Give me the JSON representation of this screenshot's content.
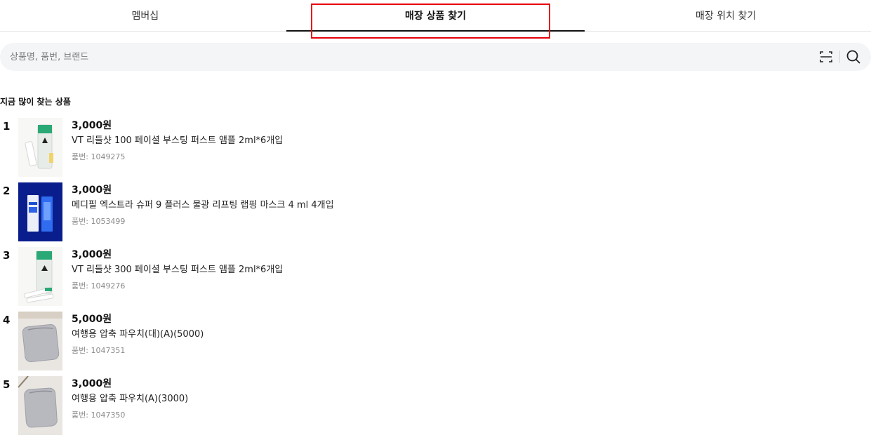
{
  "tabs": [
    {
      "label": "멤버십"
    },
    {
      "label": "매장 상품 찾기"
    },
    {
      "label": "매장 위치 찾기"
    }
  ],
  "search": {
    "placeholder": "상품명, 품번, 브랜드"
  },
  "section": {
    "title": "지금 많이 찾는 상품"
  },
  "products": [
    {
      "rank": "1",
      "price": "3,000원",
      "name": "VT 리들샷 100 페이셜 부스팅 퍼스트 앰플 2ml*6개입",
      "code": "품번: 1049275"
    },
    {
      "rank": "2",
      "price": "3,000원",
      "name": "메디필 엑스트라 슈퍼 9 플러스 물광 리프팅 랩핑 마스크 4 ml 4개입",
      "code": "품번: 1053499"
    },
    {
      "rank": "3",
      "price": "3,000원",
      "name": "VT 리들샷 300 페이셜 부스팅 퍼스트 앰플 2ml*6개입",
      "code": "품번: 1049276"
    },
    {
      "rank": "4",
      "price": "5,000원",
      "name": "여행용 압축 파우치(대)(A)(5000)",
      "code": "품번: 1047351"
    },
    {
      "rank": "5",
      "price": "3,000원",
      "name": "여행용 압축 파우치(A)(3000)",
      "code": "품번: 1047350"
    }
  ]
}
